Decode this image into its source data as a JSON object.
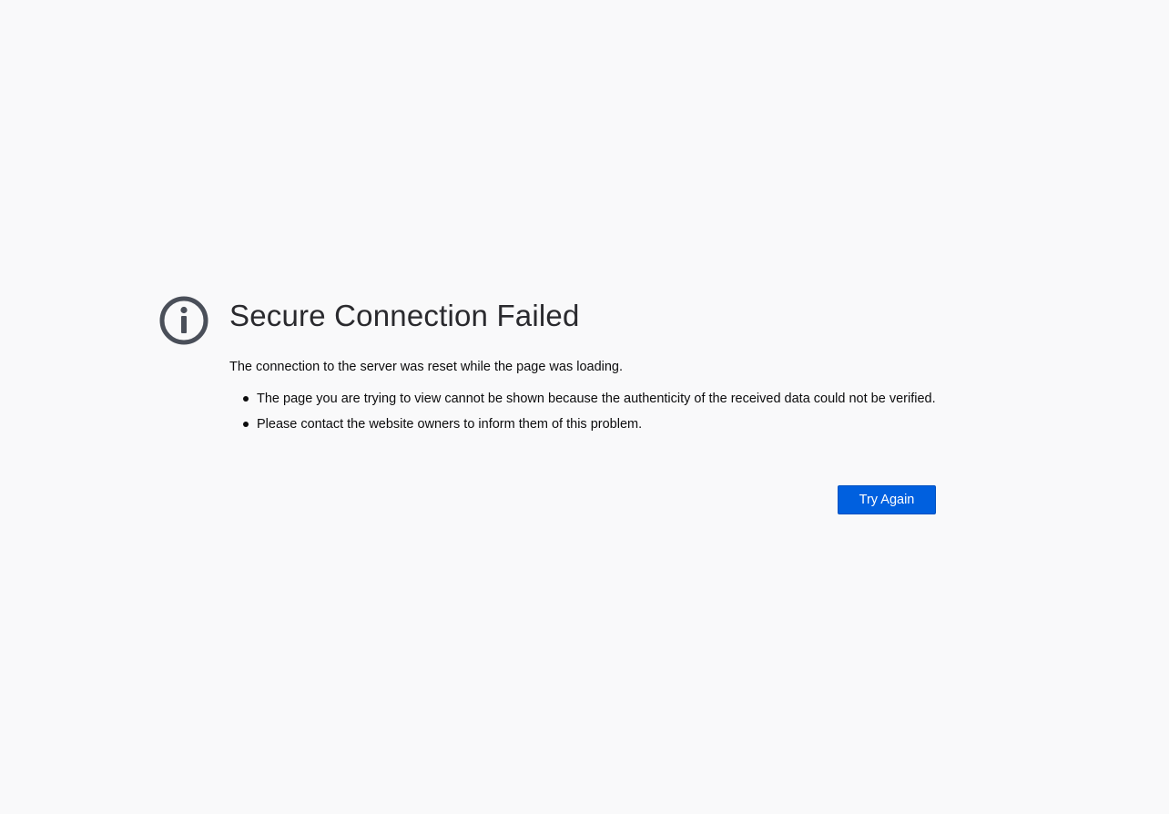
{
  "page": {
    "title": "Secure Connection Failed",
    "description": "The connection to the server was reset while the page was loading.",
    "reasons": [
      "The page you are trying to view cannot be shown because the authenticity of the received data could not be verified.",
      "Please contact the website owners to inform them of this problem."
    ],
    "try_again_label": "Try Again",
    "icon": "info-icon"
  },
  "colors": {
    "background": "#f9f9fa",
    "icon": "#4a4f59",
    "button": "#0060df"
  }
}
